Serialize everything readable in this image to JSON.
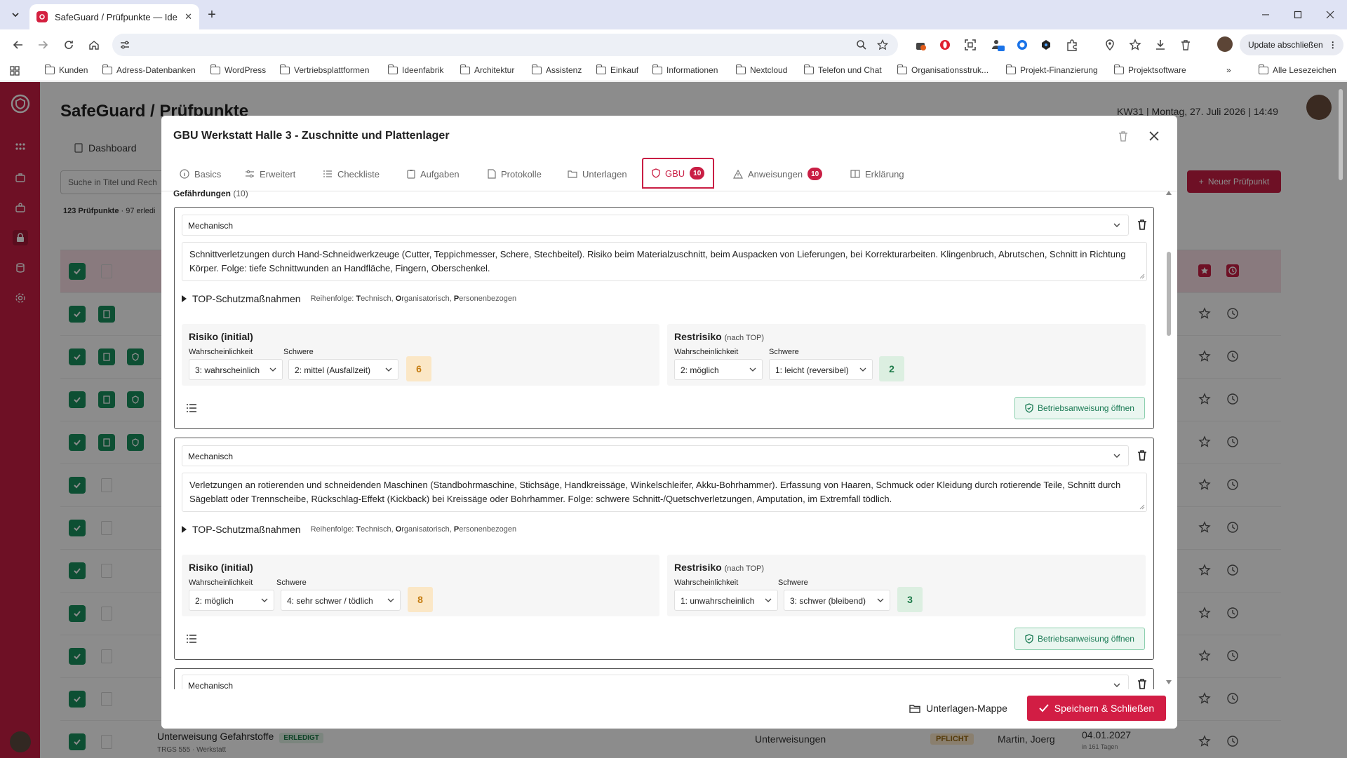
{
  "browser": {
    "tab_title": "SafeGuard / Prüfpunkte — Idee",
    "update_label": "Update abschließen",
    "bookmarks": [
      "Kunden",
      "Adress-Datenbanken",
      "WordPress",
      "Vertriebsplattformen",
      "Ideenfabrik",
      "Architektur",
      "Assistenz",
      "Einkauf",
      "Informationen",
      "Nextcloud",
      "Telefon und Chat",
      "Organisationsstruk...",
      "Projekt-Finanzierung",
      "Projektsoftware"
    ],
    "all_bookmarks": "Alle Lesezeichen"
  },
  "app": {
    "title": "SafeGuard / Prüfpunkte",
    "datetime": "KW31 | Montag, 27. Juli 2026 | 14:49",
    "nav_tab": "Dashboard",
    "search_placeholder": "Suche in Titel und Rech",
    "new_button": "Neuer Prüfpunkt",
    "count_total": "123 Prüfpunkte",
    "count_done": "97 erledi",
    "last_row": {
      "title": "Unterweisung Gefahrstoffe",
      "status": "ERLEDIGT",
      "sub": "TRGS 555 · Werkstatt",
      "category": "Unterweisungen",
      "priority": "PFLICHT",
      "person": "Martin, Joerg",
      "date": "04.01.2027",
      "due": "in 161 Tagen"
    }
  },
  "modal": {
    "title": "GBU Werkstatt Halle 3 - Zuschnitte und Plattenlager",
    "tabs": {
      "basics": "Basics",
      "erweitert": "Erweitert",
      "checkliste": "Checkliste",
      "aufgaben": "Aufgaben",
      "protokolle": "Protokolle",
      "unterlagen": "Unterlagen",
      "gbu": "GBU",
      "gbu_count": "10",
      "anweisungen": "Anweisungen",
      "anweisungen_count": "10",
      "erklaerung": "Erklärung"
    },
    "hazards_label": "Gefährdungen",
    "hazards_count": "(10)",
    "top_label": "TOP-Schutzmaßnahmen",
    "top_hint_prefix": "Reihenfolge: ",
    "top_hint_t": "T",
    "top_hint_t_rest": "echnisch, ",
    "top_hint_o": "O",
    "top_hint_o_rest": "rganisatorisch, ",
    "top_hint_p": "P",
    "top_hint_p_rest": "ersonenbezogen",
    "risk_initial": "Risiko (initial)",
    "risk_rest": "Restrisiko",
    "risk_rest_sub": "(nach TOP)",
    "lbl_probability": "Wahrscheinlichkeit",
    "lbl_severity": "Schwere",
    "ba_button": "Betriebsanweisung öffnen",
    "cards": [
      {
        "category": "Mechanisch",
        "text": "Schnittverletzungen durch Hand-Schneidwerkzeuge (Cutter, Teppichmesser, Schere, Stechbeitel). Risiko beim Materialzuschnitt, beim Auspacken von Lieferungen, bei Korrekturarbeiten. Klingenbruch, Abrutschen, Schnitt in Richtung Körper. Folge: tiefe Schnittwunden an Handfläche, Fingern, Oberschenkel.",
        "init_prob": "3: wahrscheinlich",
        "init_sev": "2: mittel (Ausfallzeit)",
        "init_score": "6",
        "rest_prob": "2: möglich",
        "rest_sev": "1: leicht (reversibel)",
        "rest_score": "2"
      },
      {
        "category": "Mechanisch",
        "text": "Verletzungen an rotierenden und schneidenden Maschinen (Standbohrmaschine, Stichsäge, Handkreissäge, Winkelschleifer, Akku-Bohrhammer). Erfassung von Haaren, Schmuck oder Kleidung durch rotierende Teile, Schnitt durch Sägeblatt oder Trennscheibe, Rückschlag-Effekt (Kickback) bei Kreissäge oder Bohrhammer. Folge: schwere Schnitt-/Quetschverletzungen, Amputation, im Extremfall tödlich.",
        "init_prob": "2: möglich",
        "init_sev": "4: sehr schwer / tödlich",
        "init_score": "8",
        "rest_prob": "1: unwahrscheinlich",
        "rest_sev": "3: schwer (bleibend)",
        "rest_score": "3"
      },
      {
        "category": "Mechanisch"
      }
    ],
    "footer_folder": "Unterlagen-Mappe",
    "footer_save": "Speichern & Schließen"
  }
}
